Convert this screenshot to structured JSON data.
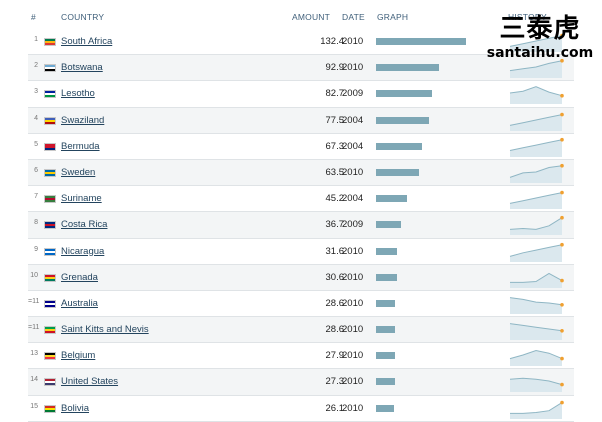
{
  "header": {
    "num": "#",
    "country": "COUNTRY",
    "amount": "AMOUNT",
    "date": "DATE",
    "graph": "GRAPH",
    "history": "HISTORY"
  },
  "watermark": {
    "chinese": "三泰虎",
    "url": "santaihu.com"
  },
  "colors": {
    "bar": "#7ea7b5",
    "spark_line": "#8fb6c4",
    "spark_fill": "#dbe8ee",
    "spark_dot": "#f0a030",
    "link": "#23445e"
  },
  "bar_max": 132.4,
  "rows": [
    {
      "rank": "1",
      "country": "South Africa",
      "amount": "132.4",
      "value": 132.4,
      "date": "2010",
      "flag": [
        "#007a4d",
        "#ffb612",
        "#de3831"
      ],
      "history": [
        0.2,
        0.35,
        0.5,
        0.65,
        0.8
      ]
    },
    {
      "rank": "2",
      "country": "Botswana",
      "amount": "92.9",
      "value": 92.9,
      "date": "2010",
      "flag": [
        "#6da9d2",
        "#ffffff",
        "#000000"
      ],
      "history": [
        0.3,
        0.4,
        0.5,
        0.7,
        0.85
      ]
    },
    {
      "rank": "3",
      "country": "Lesotho",
      "amount": "82.7",
      "value": 82.7,
      "date": "2009",
      "flag": [
        "#00209f",
        "#ffffff",
        "#009543"
      ],
      "history": [
        0.5,
        0.6,
        0.85,
        0.55,
        0.35
      ]
    },
    {
      "rank": "4",
      "country": "Swaziland",
      "amount": "77.5",
      "value": 77.5,
      "date": "2004",
      "flag": [
        "#3e5eb9",
        "#ffd900",
        "#b10c0c"
      ],
      "history": [
        0.2,
        0.35,
        0.5,
        0.65,
        0.8
      ]
    },
    {
      "rank": "5",
      "country": "Bermuda",
      "amount": "67.3",
      "value": 67.3,
      "date": "2004",
      "flag": [
        "#cf142b",
        "#cf142b",
        "#00247d"
      ],
      "history": [
        0.25,
        0.4,
        0.55,
        0.7,
        0.85
      ]
    },
    {
      "rank": "6",
      "country": "Sweden",
      "amount": "63.5",
      "value": 63.5,
      "date": "2010",
      "flag": [
        "#006aa7",
        "#fecc00",
        "#006aa7"
      ],
      "history": [
        0.2,
        0.45,
        0.5,
        0.75,
        0.85
      ]
    },
    {
      "rank": "7",
      "country": "Suriname",
      "amount": "45.2",
      "value": 45.2,
      "date": "2004",
      "flag": [
        "#377e3f",
        "#b40a2d",
        "#377e3f"
      ],
      "history": [
        0.2,
        0.35,
        0.5,
        0.65,
        0.8
      ]
    },
    {
      "rank": "8",
      "country": "Costa Rica",
      "amount": "36.7",
      "value": 36.7,
      "date": "2009",
      "flag": [
        "#002b7f",
        "#ce1126",
        "#002b7f"
      ],
      "history": [
        0.2,
        0.25,
        0.2,
        0.4,
        0.85
      ]
    },
    {
      "rank": "9",
      "country": "Nicaragua",
      "amount": "31.6",
      "value": 31.6,
      "date": "2010",
      "flag": [
        "#0067c6",
        "#ffffff",
        "#0067c6"
      ],
      "history": [
        0.2,
        0.4,
        0.55,
        0.7,
        0.85
      ]
    },
    {
      "rank": "10",
      "country": "Grenada",
      "amount": "30.6",
      "value": 30.6,
      "date": "2010",
      "flag": [
        "#ce1126",
        "#fcd116",
        "#007a5e"
      ],
      "history": [
        0.2,
        0.2,
        0.25,
        0.7,
        0.3
      ]
    },
    {
      "rank": "=11",
      "country": "Australia",
      "amount": "28.6",
      "value": 28.6,
      "date": "2010",
      "flag": [
        "#00008b",
        "#ffffff",
        "#00008b"
      ],
      "history": [
        0.8,
        0.7,
        0.55,
        0.5,
        0.4
      ]
    },
    {
      "rank": "=11",
      "country": "Saint Kitts and Nevis",
      "amount": "28.6",
      "value": 28.6,
      "date": "2010",
      "flag": [
        "#009e49",
        "#fcd116",
        "#ce1126"
      ],
      "history": [
        0.8,
        0.7,
        0.6,
        0.5,
        0.4
      ]
    },
    {
      "rank": "13",
      "country": "Belgium",
      "amount": "27.9",
      "value": 27.9,
      "date": "2010",
      "flag": [
        "#000000",
        "#fdda24",
        "#ef3340"
      ],
      "history": [
        0.3,
        0.5,
        0.75,
        0.6,
        0.3
      ]
    },
    {
      "rank": "14",
      "country": "United States",
      "amount": "27.3",
      "value": 27.3,
      "date": "2010",
      "flag": [
        "#b22234",
        "#ffffff",
        "#3c3b6e"
      ],
      "history": [
        0.6,
        0.65,
        0.6,
        0.5,
        0.3
      ]
    },
    {
      "rank": "15",
      "country": "Bolivia",
      "amount": "26.1",
      "value": 26.1,
      "date": "2010",
      "flag": [
        "#d52b1e",
        "#f9e300",
        "#007934"
      ],
      "history": [
        0.2,
        0.2,
        0.25,
        0.35,
        0.8
      ]
    }
  ]
}
